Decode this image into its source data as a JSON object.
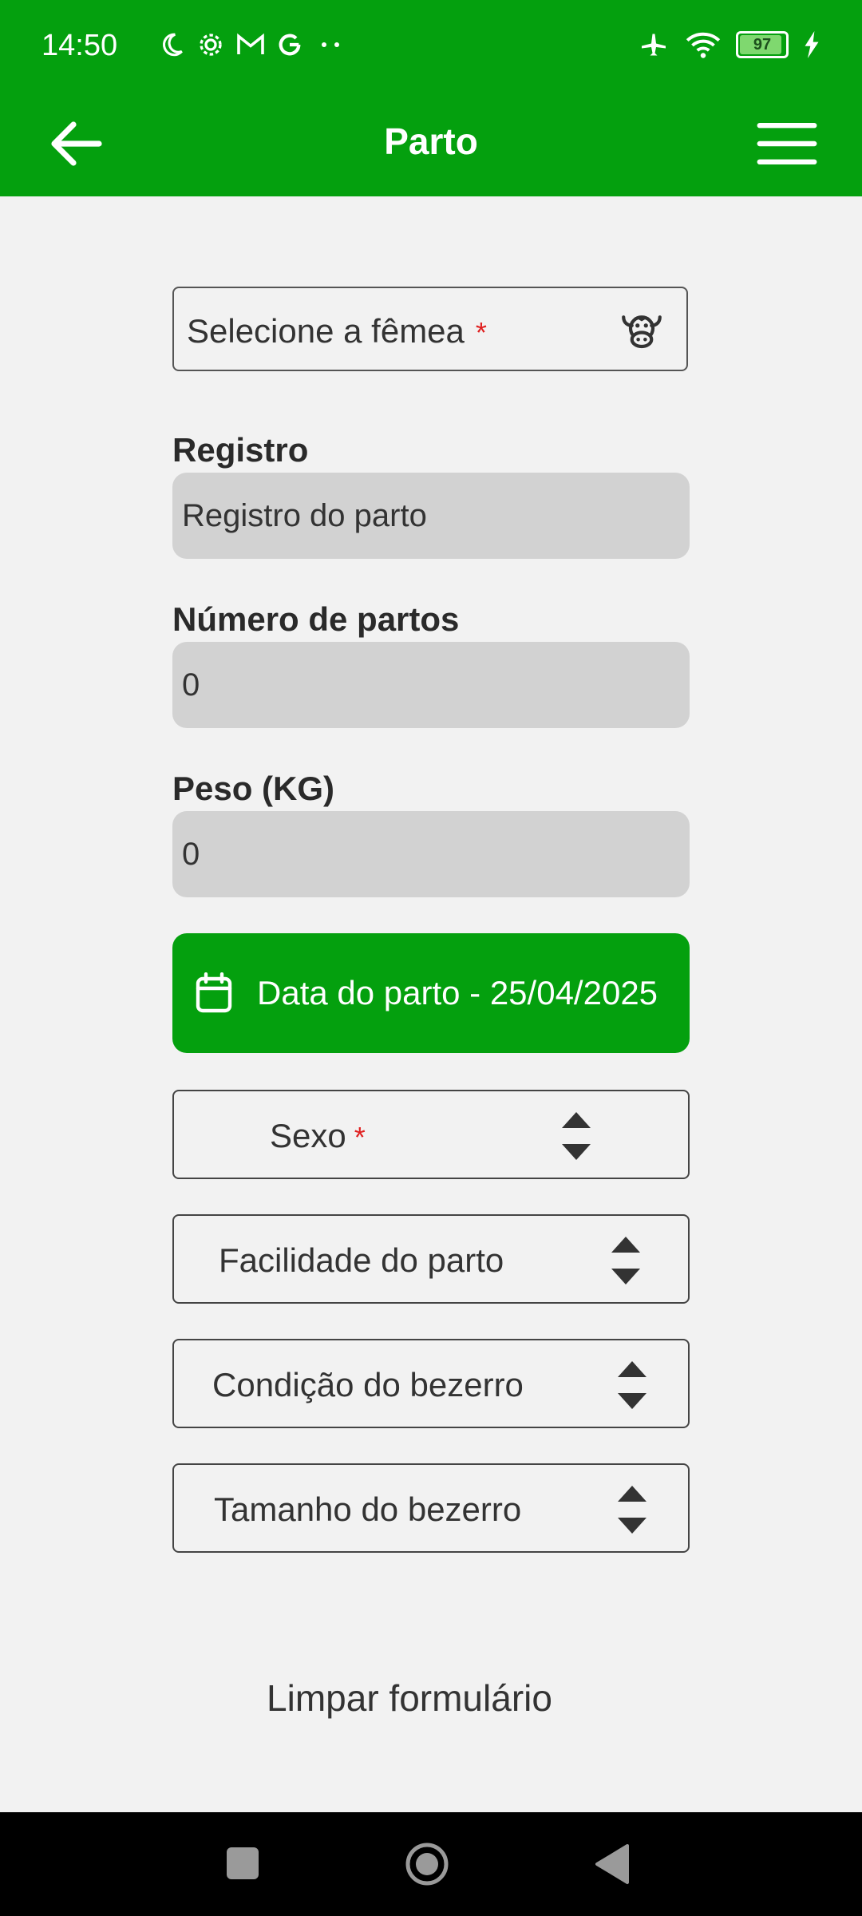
{
  "status_bar": {
    "time": "14:50",
    "battery": "97",
    "left_icons": [
      "moon-icon",
      "gear-icon",
      "gmail-icon",
      "google-icon",
      "more-dots-icon"
    ],
    "right_icons": [
      "airplane-icon",
      "wifi-icon",
      "battery-icon",
      "charging-icon"
    ]
  },
  "app_bar": {
    "title": "Parto"
  },
  "form": {
    "femea_placeholder": "Selecione a fêmea",
    "required_mark": "*",
    "registro_label": "Registro",
    "registro_placeholder": "Registro do parto",
    "num_partos_label": "Número de partos",
    "num_partos_value": "0",
    "peso_label": "Peso (KG)",
    "peso_value": "0",
    "date_button": "Data do parto - 25/04/2025",
    "sexo": "Sexo",
    "facilidade": "Facilidade do parto",
    "condicao": "Condição do bezerro",
    "tamanho": "Tamanho do bezerro",
    "clear": "Limpar formulário"
  },
  "colors": {
    "primary": "#04a00e",
    "background": "#f2f2f2",
    "field_bg": "#d2d2d2",
    "required": "#e02020"
  }
}
